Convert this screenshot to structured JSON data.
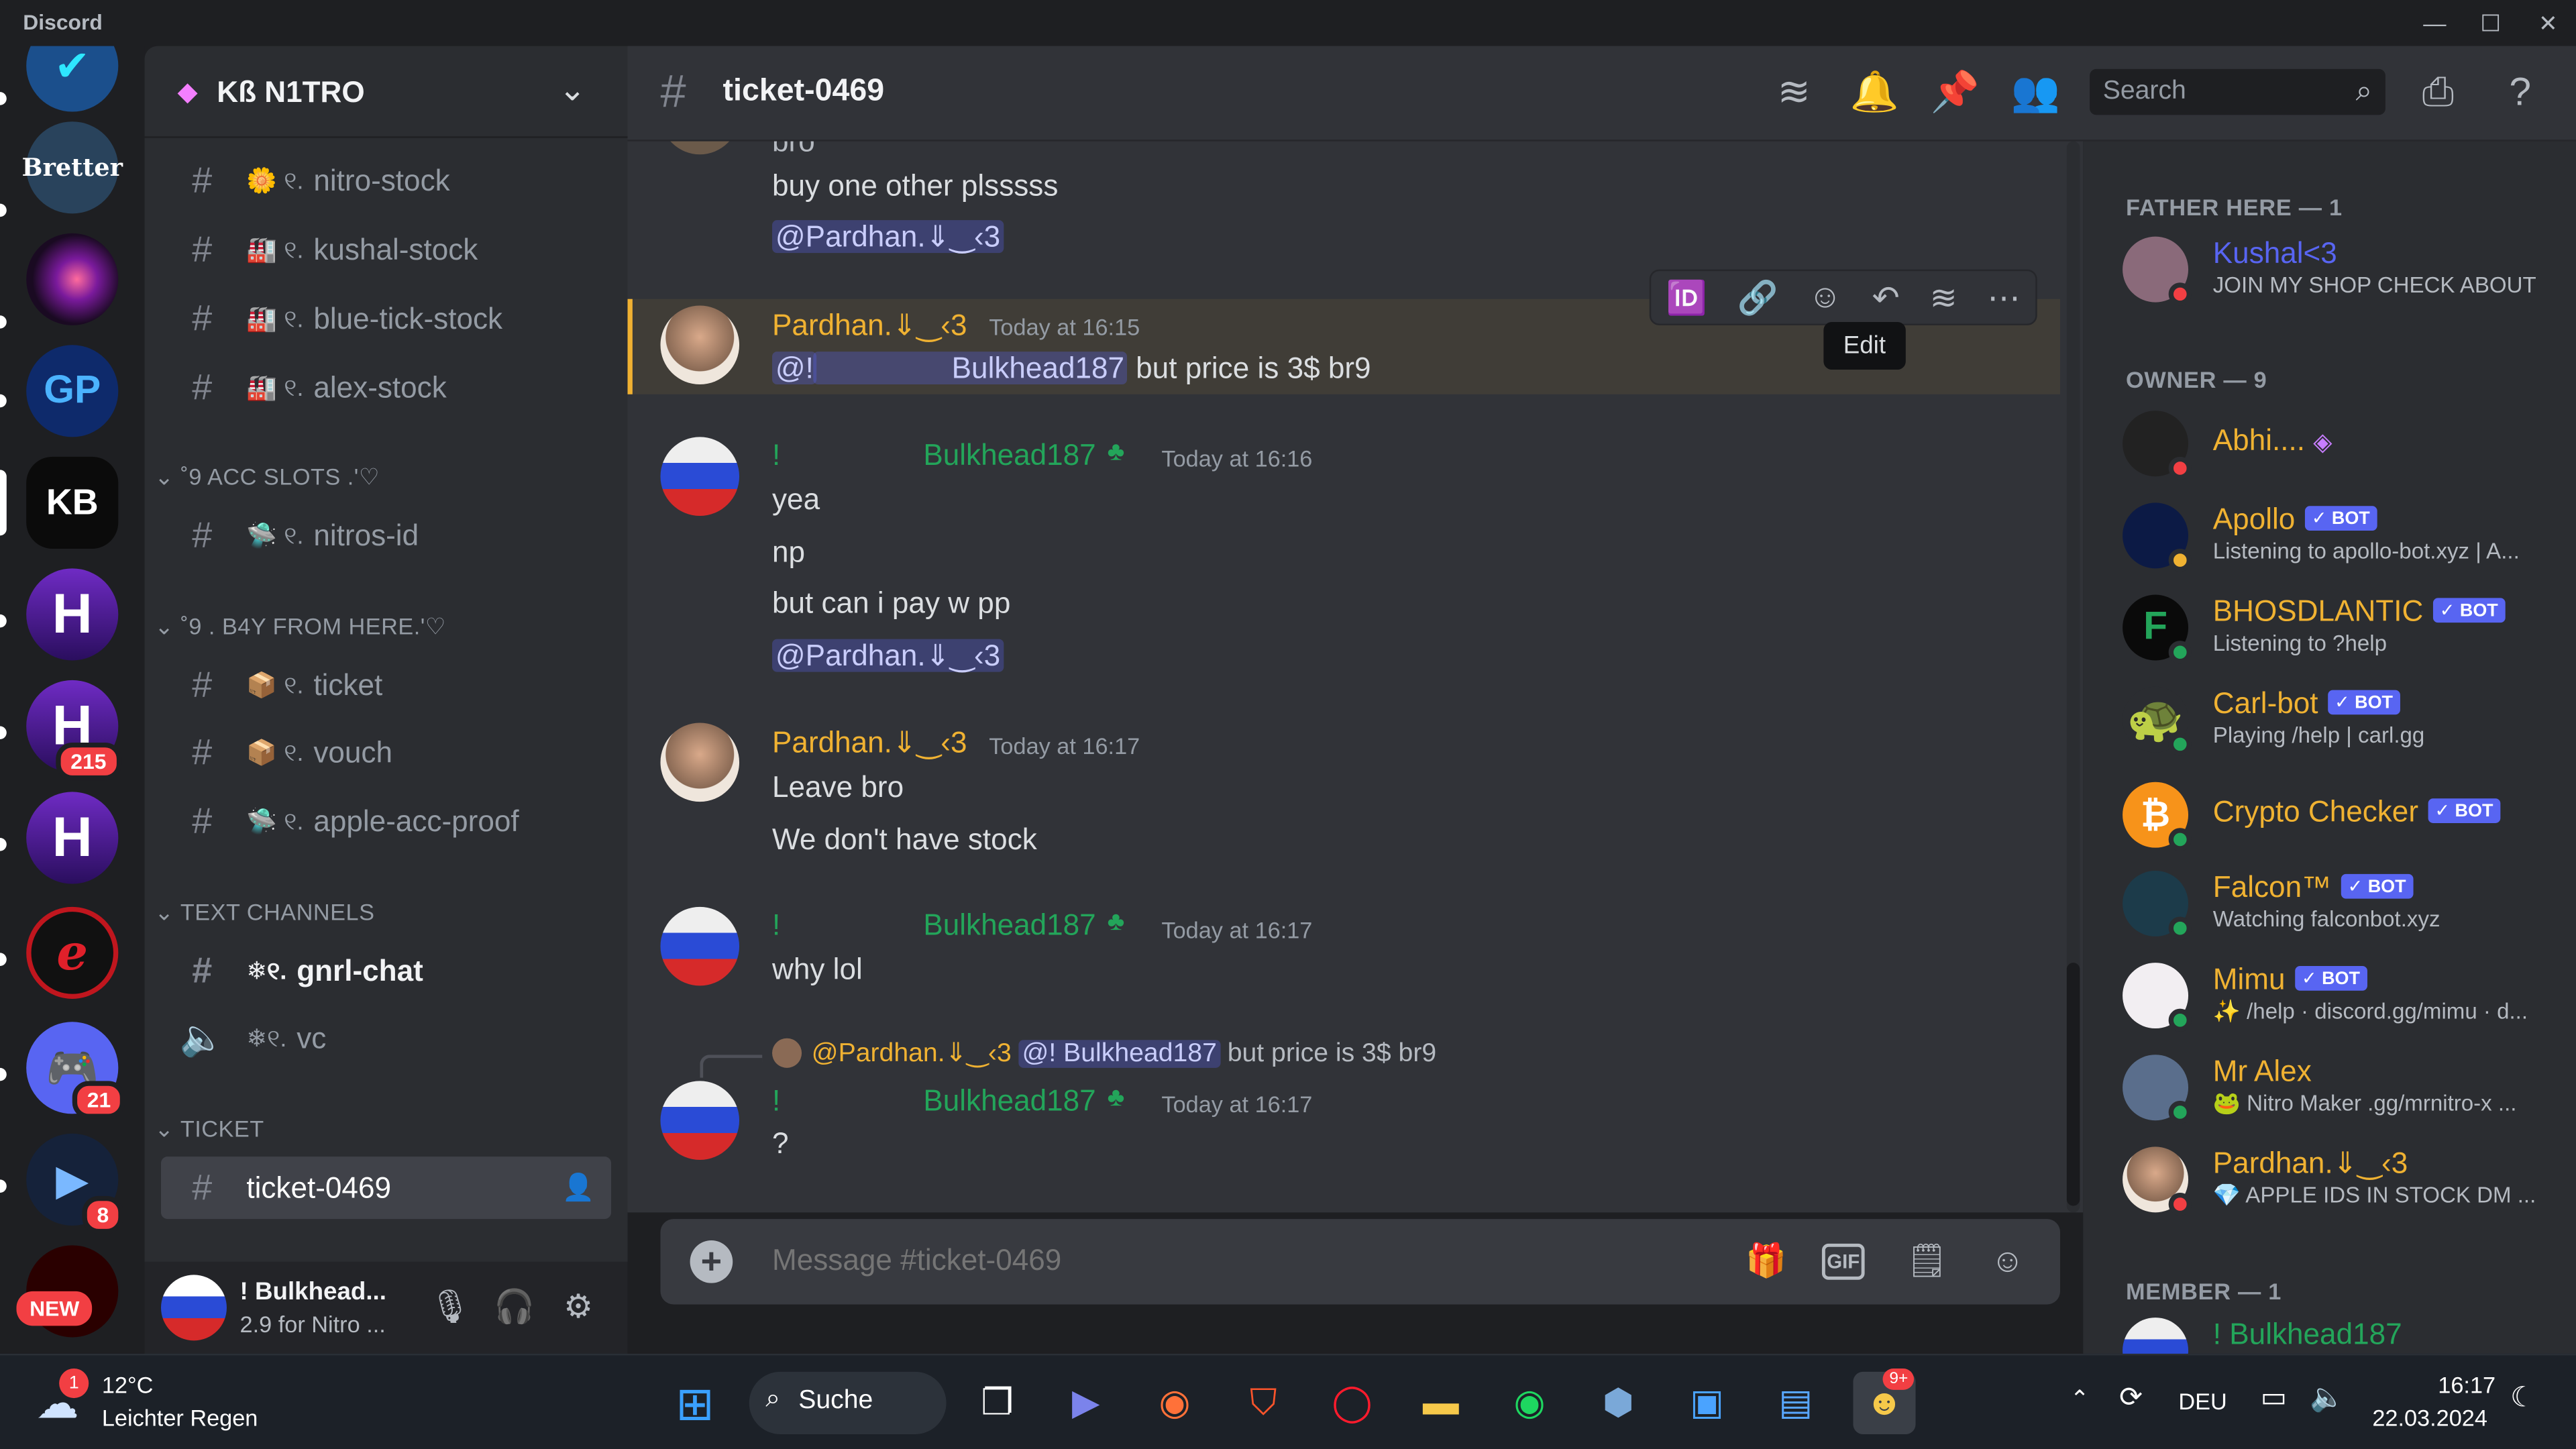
{
  "app": {
    "name": "Discord"
  },
  "window": {
    "minimize": "—",
    "maximize": "☐",
    "close": "✕"
  },
  "servers": {
    "badges": [
      "215",
      "21",
      "8"
    ],
    "new_label": "NEW",
    "initials": {
      "h1": "H",
      "h2": "H",
      "h3": "H",
      "kb": "KB",
      "gp": "GP"
    }
  },
  "guild": {
    "name": "Kß N1TRO",
    "chevron": "⌄"
  },
  "channels": {
    "top": [
      {
        "deco": "🌼 ୧.",
        "name": "nitro-stock"
      },
      {
        "deco": "🏭 ୧.",
        "name": "kushal-stock"
      },
      {
        "deco": "🏭 ୧.",
        "name": "blue-tick-stock"
      },
      {
        "deco": "🏭 ୧.",
        "name": "alex-stock"
      }
    ],
    "cat1": "⌄ ˚9 ACC SLOTS .'♡",
    "cat1_items": [
      {
        "deco": "🛸 ୧.",
        "name": "nitros-id"
      }
    ],
    "cat2": "⌄ ˚9 . B4Y FROM HERE.'♡",
    "cat2_items": [
      {
        "deco": "📦 ୧.",
        "name": "ticket"
      },
      {
        "deco": "📦 ୧.",
        "name": "vouch"
      },
      {
        "deco": "🛸 ୧.",
        "name": "apple-acc-proof"
      }
    ],
    "cat3": "⌄ TEXT CHANNELS",
    "cat3_items": [
      {
        "deco": "❄୧.",
        "name": "gnrl-chat"
      },
      {
        "deco": "❄୧.",
        "name": "vc"
      }
    ],
    "cat4": "⌄ TICKET",
    "cat4_items": [
      {
        "name": "ticket-0469"
      }
    ]
  },
  "user_panel": {
    "name": "! Bulkhead...",
    "status": "2.9 for Nitro ..."
  },
  "header": {
    "channel": "ticket-0469",
    "search_placeholder": "Search"
  },
  "messages": {
    "m0_partial": "bro",
    "m0_line1": "buy one other plsssss",
    "m0_mention": "@Pardhan.⇓‿‹3",
    "m1": {
      "author": "Pardhan.⇓‿‹3",
      "time": "Today at 16:15",
      "mention_a": "@!",
      "mention_b": "Bulkhead187",
      "text": " but price is 3$ br9"
    },
    "m2": {
      "author_prefix": "!",
      "author": "Bulkhead187",
      "time": "Today at 16:16",
      "lines": [
        "yea",
        "np",
        "but can i pay w pp"
      ],
      "mention": "@Pardhan.⇓‿‹3"
    },
    "m3": {
      "author": "Pardhan.⇓‿‹3",
      "time": "Today at 16:17",
      "lines": [
        "Leave bro",
        "We don't have stock"
      ]
    },
    "m4": {
      "author_prefix": "!",
      "author": "Bulkhead187",
      "time": "Today at 16:17",
      "text": "why lol"
    },
    "m5": {
      "reply_author": "@Pardhan.⇓‿‹3",
      "reply_mention": "@! Bulkhead187",
      "reply_text": "but price is 3$ br9",
      "author_prefix": "!",
      "author": "Bulkhead187",
      "time": "Today at 16:17",
      "text": "?"
    }
  },
  "toolbar": {
    "tooltip": "Edit"
  },
  "composer": {
    "placeholder": "Message #ticket-0469"
  },
  "members": {
    "g1": "FATHER HERE — 1",
    "g2": "OWNER — 9",
    "g3": "MEMBER — 1",
    "list": [
      {
        "name": "Kushal<3",
        "status": "JOIN MY SHOP CHECK ABOUT",
        "color": "#5865f2"
      },
      {
        "name": "Abhi....",
        "status": "",
        "color": "#f0b232"
      },
      {
        "name": "Apollo",
        "bot": "✓ BOT",
        "status": "Listening to apollo-bot.xyz | A...",
        "color": "#f0b232"
      },
      {
        "name": "BHOSDLANTIC",
        "bot": "✓ BOT",
        "status": "Listening to ?help",
        "color": "#f0b232"
      },
      {
        "name": "Carl-bot",
        "bot": "✓ BOT",
        "status": "Playing /help | carl.gg",
        "color": "#f0b232"
      },
      {
        "name": "Crypto Checker",
        "bot": "✓ BOT",
        "status": "",
        "color": "#f0b232"
      },
      {
        "name": "Falcon™",
        "bot": "✓ BOT",
        "status": "Watching falconbot.xyz",
        "color": "#f0b232"
      },
      {
        "name": "Mimu",
        "bot": "✓ BOT",
        "status": "✨ /help · discord.gg/mimu · d...",
        "color": "#f0b232"
      },
      {
        "name": "Mr Alex",
        "status": "🐸 Nitro Maker .gg/mrnitro-x ...",
        "color": "#f0b232"
      },
      {
        "name": "Pardhan.⇓‿‹3",
        "status": "💎 APPLE IDS IN STOCK DM ...",
        "color": "#f0b232"
      },
      {
        "name": "! Bulkhead187",
        "status": "",
        "color": "#23a55a"
      }
    ]
  },
  "taskbar": {
    "weather_temp": "12°C",
    "weather_desc": "Leichter Regen",
    "weather_badge": "1",
    "search": "Suche",
    "lang": "DEU",
    "time": "16:17",
    "date": "22.03.2024",
    "discord_badge": "9+"
  },
  "colors": {
    "accent": "#5865f2",
    "gold": "#f0b232",
    "green": "#23a55a",
    "red": "#f23f43"
  }
}
